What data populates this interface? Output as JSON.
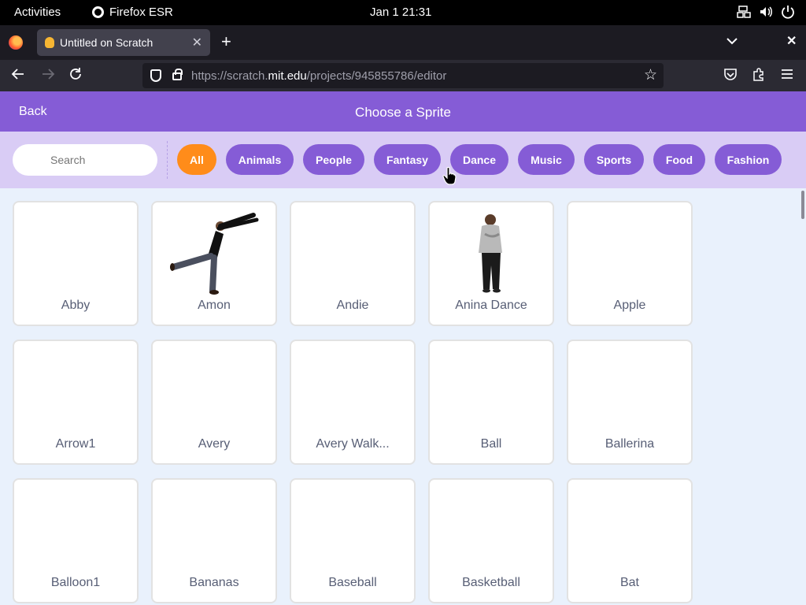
{
  "system_bar": {
    "activities": "Activities",
    "app_name": "Firefox ESR",
    "datetime": "Jan 1  21:31"
  },
  "browser": {
    "tab_title": "Untitled on Scratch",
    "url_prefix": "https://scratch.",
    "url_host": "mit.edu",
    "url_path": "/projects/945855786/editor",
    "new_tab": "+"
  },
  "header": {
    "back_label": "Back",
    "title": "Choose a Sprite"
  },
  "search": {
    "placeholder": "Search"
  },
  "tags": [
    {
      "label": "All",
      "active": true
    },
    {
      "label": "Animals"
    },
    {
      "label": "People"
    },
    {
      "label": "Fantasy"
    },
    {
      "label": "Dance"
    },
    {
      "label": "Music"
    },
    {
      "label": "Sports"
    },
    {
      "label": "Food"
    },
    {
      "label": "Fashion"
    }
  ],
  "sprites": [
    {
      "name": "Abby"
    },
    {
      "name": "Amon",
      "image": "dancer-kicking-figure"
    },
    {
      "name": "Andie"
    },
    {
      "name": "Anina Dance",
      "image": "dancer-standing-figure"
    },
    {
      "name": "Apple"
    },
    {
      "name": "Arrow1"
    },
    {
      "name": "Avery"
    },
    {
      "name": "Avery Walk..."
    },
    {
      "name": "Ball"
    },
    {
      "name": "Ballerina"
    },
    {
      "name": "Balloon1"
    },
    {
      "name": "Bananas"
    },
    {
      "name": "Baseball"
    },
    {
      "name": "Basketball"
    },
    {
      "name": "Bat"
    }
  ],
  "colors": {
    "scratch_purple": "#855cd6",
    "active_tag": "#ff8c1a",
    "filter_bar": "#d9ccf5",
    "page_bg": "#e9f1fc"
  }
}
